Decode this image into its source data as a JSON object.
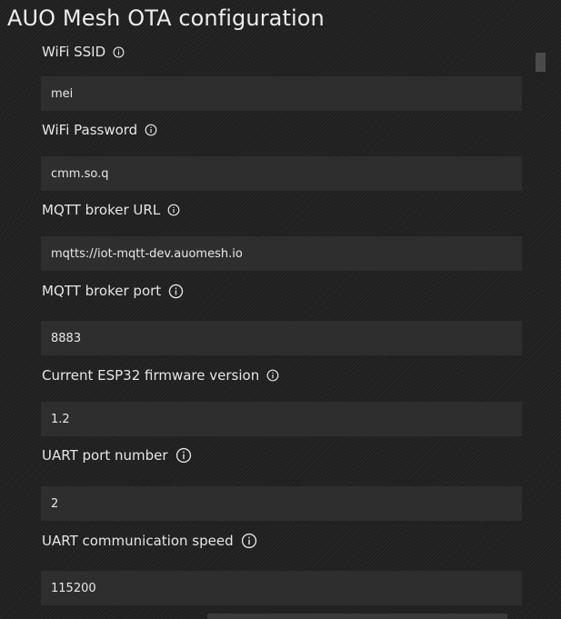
{
  "app": {
    "title": "AUO Mesh OTA configuration"
  },
  "fields": [
    {
      "label": "WiFi SSID",
      "value": "mei",
      "info_icon": "info-circle-icon"
    },
    {
      "label": "WiFi Password",
      "value": "cmm.so.q",
      "info_icon": "info-circle-icon"
    },
    {
      "label": "MQTT broker URL",
      "value": "mqtts://iot-mqtt-dev.auomesh.io",
      "info_icon": "info-circle-icon"
    },
    {
      "label": "MQTT broker port",
      "value": "8883",
      "info_icon": "info-circle-icon"
    },
    {
      "label": "Current ESP32 firmware version",
      "value": "1.2",
      "info_icon": "info-circle-icon"
    },
    {
      "label": "UART port number",
      "value": "2",
      "info_icon": "info-circle-icon"
    },
    {
      "label": "UART communication speed",
      "value": "115200",
      "info_icon": "info-circle-icon"
    }
  ],
  "colors": {
    "background": "#1f1f1f",
    "input_background": "#2e2e2e",
    "text": "#e6e6e6"
  }
}
